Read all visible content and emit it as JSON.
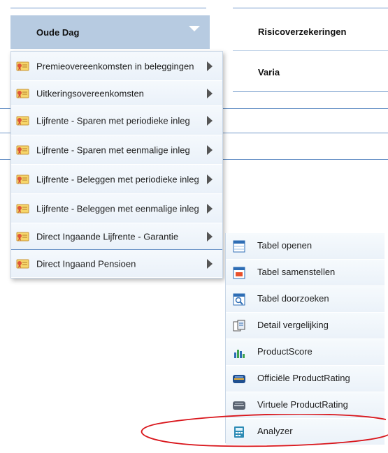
{
  "nav": {
    "oude_dag": "Oude Dag",
    "risico": "Risicoverzekeringen",
    "varia": "Varia"
  },
  "menu": {
    "items": [
      {
        "label": "Premieovereenkomsten in beleggingen",
        "icon": "certificate-icon"
      },
      {
        "label": "Uitkeringsovereenkomsten",
        "icon": "certificate-icon"
      },
      {
        "label": "Lijfrente - Sparen met periodieke inleg",
        "icon": "certificate-icon"
      },
      {
        "label": "Lijfrente - Sparen met eenmalige inleg",
        "icon": "certificate-icon"
      },
      {
        "label": "Lijfrente - Beleggen met periodieke inleg",
        "icon": "certificate-icon"
      },
      {
        "label": "Lijfrente - Beleggen met eenmalige inleg",
        "icon": "certificate-icon"
      },
      {
        "label": "Direct Ingaande Lijfrente - Garantie",
        "icon": "certificate-icon"
      },
      {
        "label": "Direct Ingaand Pensioen",
        "icon": "certificate-icon"
      }
    ]
  },
  "submenu": {
    "items": [
      {
        "label": "Tabel openen",
        "icon": "table-open-icon"
      },
      {
        "label": "Tabel samenstellen",
        "icon": "table-compose-icon"
      },
      {
        "label": "Tabel doorzoeken",
        "icon": "table-search-icon"
      },
      {
        "label": "Detail vergelijking",
        "icon": "document-compare-icon"
      },
      {
        "label": "ProductScore",
        "icon": "bar-chart-icon"
      },
      {
        "label": "Officiële ProductRating",
        "icon": "rating-badge-icon"
      },
      {
        "label": "Virtuele ProductRating",
        "icon": "rating-badge-gray-icon"
      },
      {
        "label": "Analyzer",
        "icon": "calculator-icon"
      }
    ]
  },
  "colors": {
    "header_bg": "#b7cbe1",
    "divider": "#6f97c9",
    "annotation": "#d9151b"
  }
}
